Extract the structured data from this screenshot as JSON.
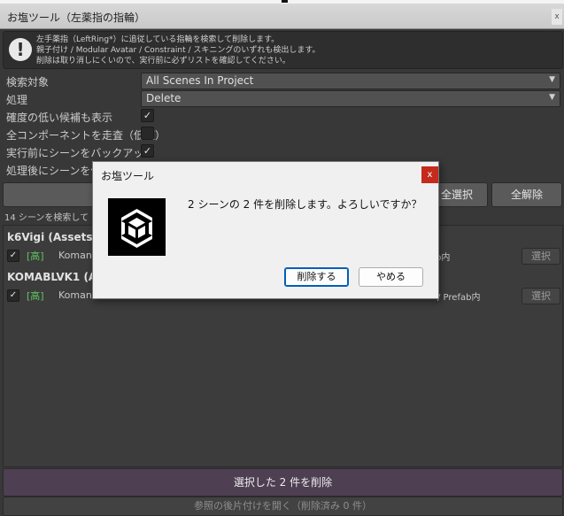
{
  "window": {
    "title": "お塩ツール（左薬指の指輪）"
  },
  "help": {
    "lines": [
      "左手薬指（LeftRing*）に追従している指輪を検索して削除します。",
      "親子付け / Modular Avatar / Constraint / スキニングのいずれも検出します。",
      "削除は取り消しにくいので、実行前に必ずリストを確認してください。"
    ]
  },
  "fields": {
    "search_target": {
      "label": "検索対象",
      "value": "All Scenes In Project"
    },
    "process": {
      "label": "処理",
      "value": "Delete"
    },
    "show_low": {
      "label": "確度の低い候補も表示",
      "checked": true
    },
    "scan_all": {
      "label": "全コンポーネントを走査（低速）",
      "checked": false
    },
    "backup": {
      "label": "実行前にシーンをバックアップ",
      "checked": true
    },
    "save_after": {
      "label": "処理後にシーンを保存",
      "checked": false
    }
  },
  "toolbar": {
    "select_all": "全選択",
    "deselect_all": "全解除"
  },
  "status": "14 シーンを検索して 2 件",
  "results": [
    {
      "scene": "k6Vigi (Assets/",
      "items": [
        {
          "checked": true,
          "confidence": "[高]",
          "name": "Koman",
          "location": "b内",
          "select_label": "選択"
        }
      ]
    },
    {
      "scene": "KOMABLVK1 (As",
      "items": [
        {
          "checked": true,
          "confidence": "[高]",
          "name": "Koman",
          "location": "/ Prefab内",
          "select_label": "選択"
        }
      ]
    }
  ],
  "actions": {
    "delete_selected": "選択した 2 件を削除",
    "open_cleanup": "参照の後片付けを開く（削除済み 0 件）"
  },
  "dialog": {
    "title": "お塩ツール",
    "close": "x",
    "message": "2 シーンの 2 件を削除します。よろしいですか？",
    "confirm": "削除する",
    "cancel": "やめる"
  },
  "colors": {
    "accent_delete": "#4e3f52",
    "confidence_high": "#62c462",
    "dialog_close": "#c42b1c"
  },
  "icons": {
    "help": "exclamation-icon",
    "dialog_logo": "unity-logo-icon"
  }
}
